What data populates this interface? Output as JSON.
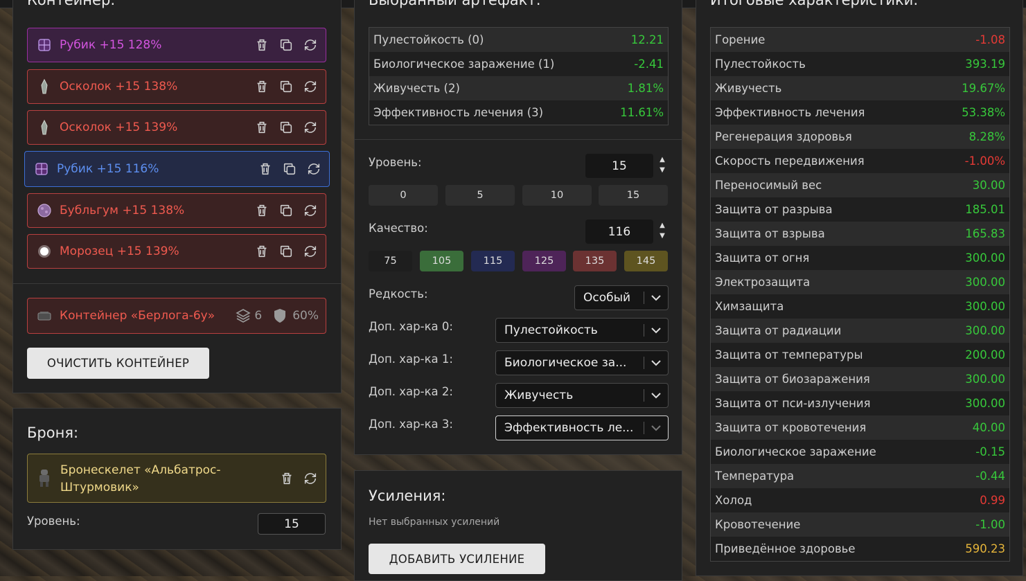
{
  "container_panel": {
    "title": "Контейнер:",
    "items": [
      {
        "label": "Рубик +15 128%"
      },
      {
        "label": "Осколок +15 138%"
      },
      {
        "label": "Осколок +15 139%"
      },
      {
        "label": "Рубик +15 116%"
      },
      {
        "label": "Бубльгум +15 138%"
      },
      {
        "label": "Морозец +15 139%"
      }
    ],
    "container_name": "Контейнер «Берлога-6у»",
    "slots": "6",
    "protection": "60%",
    "clear_button": "ОЧИСТИТЬ КОНТЕЙНЕР"
  },
  "armor_panel": {
    "title": "Броня:",
    "armor_line1": "Бронескелет «Альбатрос-",
    "armor_line2": "Штурмовик»",
    "level_label": "Уровень:",
    "level_value": "15"
  },
  "artifact_panel": {
    "title": "Выбранный артефакт:",
    "stats": [
      {
        "name": "Пулестойкость (0)",
        "value": "12.21",
        "tone": "pos"
      },
      {
        "name": "Биологическое заражение (1)",
        "value": "-2.41",
        "tone": "pos"
      },
      {
        "name": "Живучесть (2)",
        "value": "1.81%",
        "tone": "pos"
      },
      {
        "name": "Эффективность лечения (3)",
        "value": "11.61%",
        "tone": "pos"
      }
    ],
    "level_label": "Уровень:",
    "level_value": "15",
    "level_presets": [
      "0",
      "5",
      "10",
      "15"
    ],
    "quality_label": "Качество:",
    "quality_value": "116",
    "quality_presets": [
      {
        "label": "75",
        "color": "#1e1e1e"
      },
      {
        "label": "105",
        "color": "#3a6d3a"
      },
      {
        "label": "115",
        "color": "#232a52"
      },
      {
        "label": "125",
        "color": "#4e2458"
      },
      {
        "label": "135",
        "color": "#6b3232"
      },
      {
        "label": "145",
        "color": "#5e5420"
      }
    ],
    "rarity_label": "Редкость:",
    "rarity_value": "Особый",
    "extra_labels": [
      "Доп. хар-ка 0:",
      "Доп. хар-ка 1:",
      "Доп. хар-ка 2:",
      "Доп. хар-ка 3:"
    ],
    "extra_values": [
      "Пулестойкость",
      "Биологическое за...",
      "Живучесть",
      "Эффективность ле..."
    ]
  },
  "boost_panel": {
    "title": "Усиления:",
    "empty_text": "Нет выбранных усилений",
    "add_button": "ДОБАВИТЬ УСИЛЕНИЕ"
  },
  "totals_panel": {
    "title": "Итоговые характеристики:",
    "stats": [
      {
        "name": "Горение",
        "value": "-1.08",
        "tone": "neg"
      },
      {
        "name": "Пулестойкость",
        "value": "393.19",
        "tone": "pos"
      },
      {
        "name": "Живучесть",
        "value": "19.67%",
        "tone": "pos"
      },
      {
        "name": "Эффективность лечения",
        "value": "53.38%",
        "tone": "pos"
      },
      {
        "name": "Регенерация здоровья",
        "value": "8.28%",
        "tone": "pos"
      },
      {
        "name": "Скорость передвижения",
        "value": "-1.00%",
        "tone": "neg"
      },
      {
        "name": "Переносимый вес",
        "value": "30.00",
        "tone": "pos"
      },
      {
        "name": "Защита от разрыва",
        "value": "185.01",
        "tone": "pos"
      },
      {
        "name": "Защита от взрыва",
        "value": "165.83",
        "tone": "pos"
      },
      {
        "name": "Защита от огня",
        "value": "300.00",
        "tone": "pos"
      },
      {
        "name": "Электрозащита",
        "value": "300.00",
        "tone": "pos"
      },
      {
        "name": "Химзащита",
        "value": "300.00",
        "tone": "pos"
      },
      {
        "name": "Защита от радиации",
        "value": "300.00",
        "tone": "pos"
      },
      {
        "name": "Защита от температуры",
        "value": "200.00",
        "tone": "pos"
      },
      {
        "name": "Защита от биозаражения",
        "value": "300.00",
        "tone": "pos"
      },
      {
        "name": "Защита от пси-излучения",
        "value": "300.00",
        "tone": "pos"
      },
      {
        "name": "Защита от кровотечения",
        "value": "40.00",
        "tone": "pos"
      },
      {
        "name": "Биологическое заражение",
        "value": "-0.15",
        "tone": "pos"
      },
      {
        "name": "Температура",
        "value": "-0.44",
        "tone": "pos"
      },
      {
        "name": "Холод",
        "value": "0.99",
        "tone": "neg"
      },
      {
        "name": "Кровотечение",
        "value": "-1.00",
        "tone": "pos"
      },
      {
        "name": "Приведённое здоровье",
        "value": "590.23",
        "tone": "gold"
      }
    ]
  }
}
